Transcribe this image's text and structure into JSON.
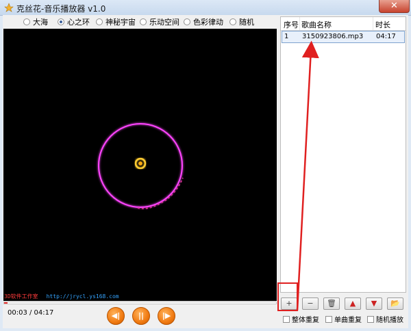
{
  "window": {
    "title": "克丝花-音乐播放器 v1.0",
    "close_label": "✕"
  },
  "modes": [
    {
      "label": "大海",
      "selected": false
    },
    {
      "label": "心之环",
      "selected": true
    },
    {
      "label": "神秘宇宙",
      "selected": false
    },
    {
      "label": "乐动空间",
      "selected": false
    },
    {
      "label": "色彩律动",
      "selected": false
    },
    {
      "label": "随机",
      "selected": false
    }
  ],
  "brand": {
    "studio": "3D软件工作室",
    "url": "http://jrycl.ys168.com"
  },
  "player": {
    "time": "00:03 / 04:17",
    "progress": 0.012,
    "prev_icon": "prev-icon",
    "pause_icon": "pause-icon",
    "next_icon": "next-icon"
  },
  "playlist": {
    "columns": [
      "序号",
      "歌曲名称",
      "时长"
    ],
    "rows": [
      {
        "index": "1",
        "name": "3150923806.mp3",
        "duration": "04:17"
      }
    ]
  },
  "toolbar": {
    "add": "+",
    "remove": "−",
    "clear": "🗑",
    "up": "▲",
    "down": "▼",
    "open": "📂"
  },
  "options": {
    "whole_repeat": "整体重复",
    "single_repeat": "单曲重复",
    "random_play": "随机播放"
  },
  "colors": {
    "ring": "#ff44ff",
    "core": "#ffcc33",
    "annotation": "#e02020",
    "controls": "#f07a11"
  }
}
